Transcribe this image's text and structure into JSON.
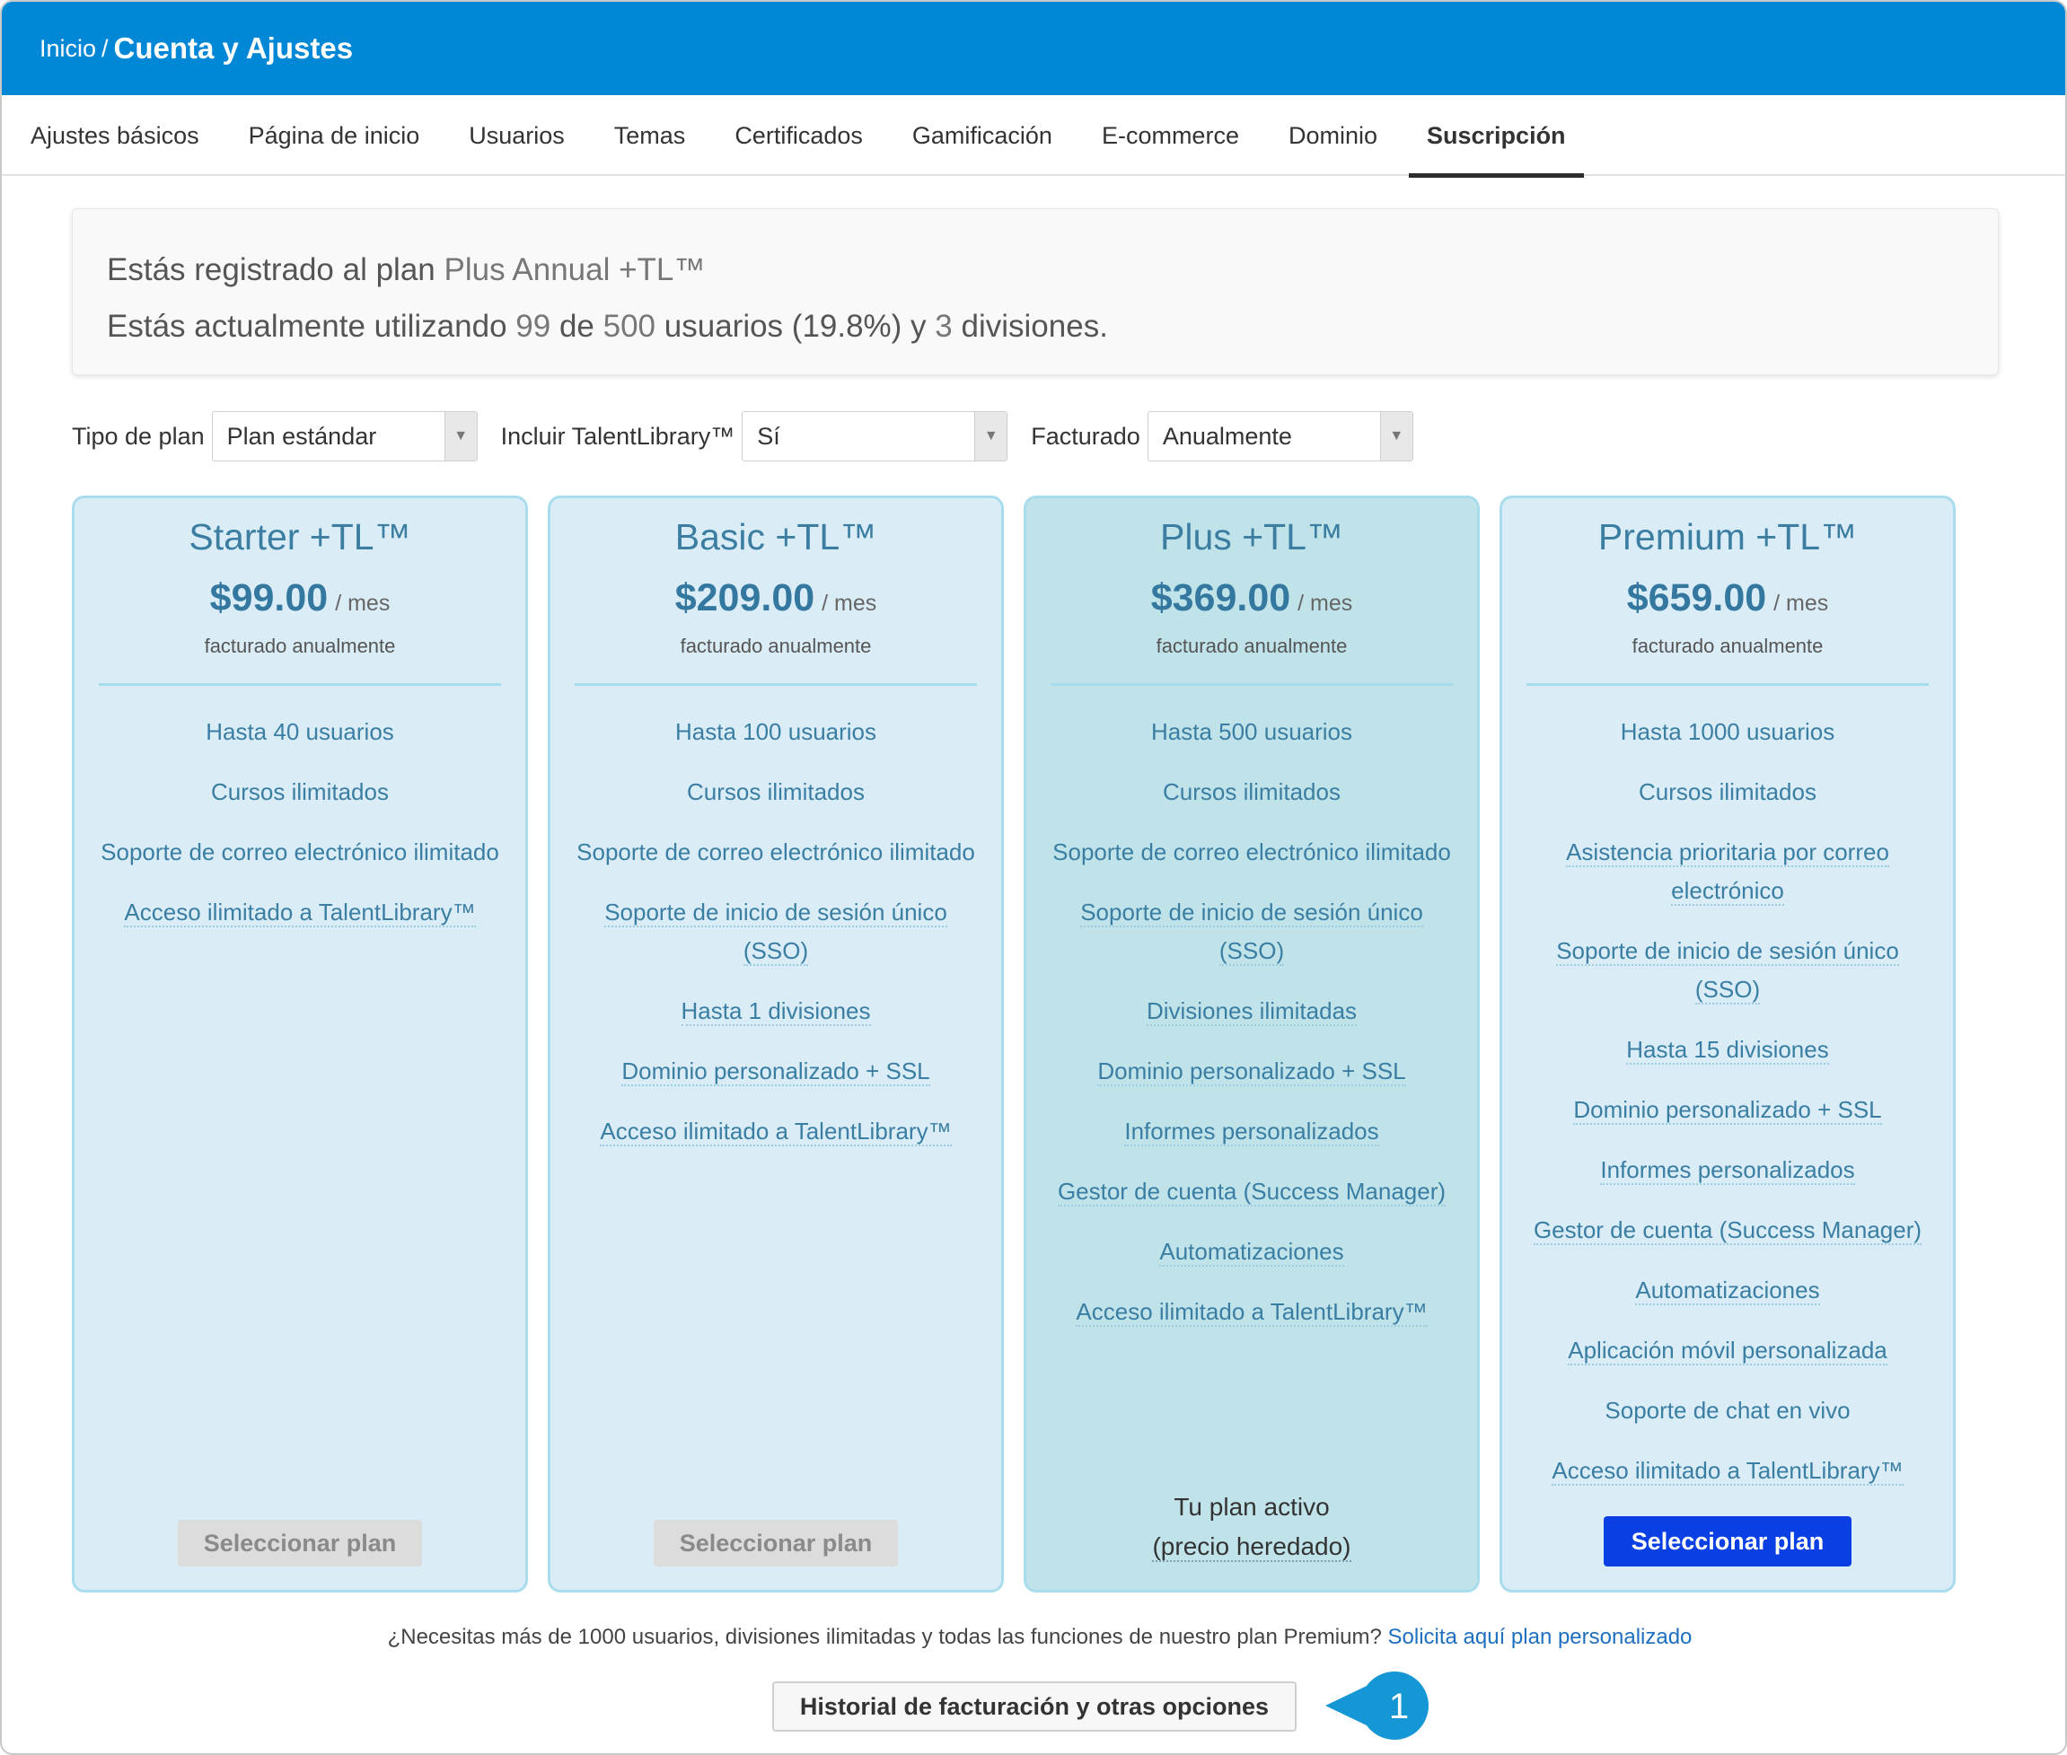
{
  "header": {
    "breadcrumb_home": "Inicio",
    "breadcrumb_sep": "/",
    "title": "Cuenta y Ajustes"
  },
  "tabs": [
    {
      "label": "Ajustes básicos",
      "active": false
    },
    {
      "label": "Página de inicio",
      "active": false
    },
    {
      "label": "Usuarios",
      "active": false
    },
    {
      "label": "Temas",
      "active": false
    },
    {
      "label": "Certificados",
      "active": false
    },
    {
      "label": "Gamificación",
      "active": false
    },
    {
      "label": "E-commerce",
      "active": false
    },
    {
      "label": "Dominio",
      "active": false
    },
    {
      "label": "Suscripción",
      "active": true
    }
  ],
  "status": {
    "line1_prefix": "Estás registrado al plan",
    "plan_name": "Plus Annual +TL™",
    "line2_prefix": "Estás actualmente utilizando",
    "users_used": "99",
    "line2_de": "de",
    "users_total": "500",
    "line2_mid": "usuarios (19.8%) y",
    "divisions": "3",
    "line2_suffix": "divisiones."
  },
  "filters": {
    "plan_type_label": "Tipo de plan",
    "plan_type_value": "Plan estándar",
    "talentlibrary_label": "Incluir TalentLibrary™",
    "talentlibrary_value": "Sí",
    "billing_label": "Facturado",
    "billing_value": "Anualmente"
  },
  "plans": [
    {
      "name": "Starter +TL™",
      "price": "$99.00",
      "per": "/ mes",
      "billing": "facturado anualmente",
      "features": [
        {
          "text": "Hasta 40 usuarios",
          "dotted": false
        },
        {
          "text": "Cursos ilimitados",
          "dotted": false
        },
        {
          "text": "Soporte de correo electrónico ilimitado",
          "dotted": false
        },
        {
          "text": "Acceso ilimitado a TalentLibrary™",
          "dotted": true
        }
      ],
      "action": "Seleccionar plan"
    },
    {
      "name": "Basic +TL™",
      "price": "$209.00",
      "per": "/ mes",
      "billing": "facturado anualmente",
      "features": [
        {
          "text": "Hasta 100 usuarios",
          "dotted": false
        },
        {
          "text": "Cursos ilimitados",
          "dotted": false
        },
        {
          "text": "Soporte de correo electrónico ilimitado",
          "dotted": false
        },
        {
          "text": "Soporte de inicio de sesión único (SSO)",
          "dotted": true
        },
        {
          "text": "Hasta 1 divisiones",
          "dotted": true
        },
        {
          "text": "Dominio personalizado + SSL",
          "dotted": true
        },
        {
          "text": "Acceso ilimitado a TalentLibrary™",
          "dotted": true
        }
      ],
      "action": "Seleccionar plan"
    },
    {
      "name": "Plus +TL™",
      "price": "$369.00",
      "per": "/ mes",
      "billing": "facturado anualmente",
      "features": [
        {
          "text": "Hasta 500 usuarios",
          "dotted": false
        },
        {
          "text": "Cursos ilimitados",
          "dotted": false
        },
        {
          "text": "Soporte de correo electrónico ilimitado",
          "dotted": false
        },
        {
          "text": "Soporte de inicio de sesión único (SSO)",
          "dotted": true
        },
        {
          "text": "Divisiones ilimitadas",
          "dotted": true
        },
        {
          "text": "Dominio personalizado + SSL",
          "dotted": true
        },
        {
          "text": "Informes personalizados",
          "dotted": true
        },
        {
          "text": "Gestor de cuenta (Success Manager)",
          "dotted": true
        },
        {
          "text": "Automatizaciones",
          "dotted": true
        },
        {
          "text": "Acceso ilimitado a TalentLibrary™",
          "dotted": true
        }
      ],
      "active_line1": "Tu plan activo",
      "active_line2": "(precio heredado)"
    },
    {
      "name": "Premium +TL™",
      "price": "$659.00",
      "per": "/ mes",
      "billing": "facturado anualmente",
      "features": [
        {
          "text": "Hasta 1000 usuarios",
          "dotted": false
        },
        {
          "text": "Cursos ilimitados",
          "dotted": false
        },
        {
          "text": "Asistencia prioritaria por correo electrónico",
          "dotted": true
        },
        {
          "text": "Soporte de inicio de sesión único (SSO)",
          "dotted": true
        },
        {
          "text": "Hasta 15 divisiones",
          "dotted": true
        },
        {
          "text": "Dominio personalizado + SSL",
          "dotted": true
        },
        {
          "text": "Informes personalizados",
          "dotted": true
        },
        {
          "text": "Gestor de cuenta (Success Manager)",
          "dotted": true
        },
        {
          "text": "Automatizaciones",
          "dotted": true
        },
        {
          "text": "Aplicación móvil personalizada",
          "dotted": true
        },
        {
          "text": "Soporte de chat en vivo",
          "dotted": false
        },
        {
          "text": "Acceso ilimitado a TalentLibrary™",
          "dotted": true
        }
      ],
      "action": "Seleccionar plan"
    }
  ],
  "footer": {
    "note": "¿Necesitas más de 1000 usuarios, divisiones ilimitadas y todas las funciones de nuestro plan Premium?",
    "link": "Solicita aquí plan personalizado",
    "history_button": "Historial de facturación y otras opciones",
    "callout_number": "1"
  },
  "colors": {
    "header_bg": "#0087d6",
    "plan_bg": "#daedf7",
    "current_plan_bg": "#c0e3ea",
    "primary_button": "#0a3fe4",
    "callout": "#1597d5"
  }
}
